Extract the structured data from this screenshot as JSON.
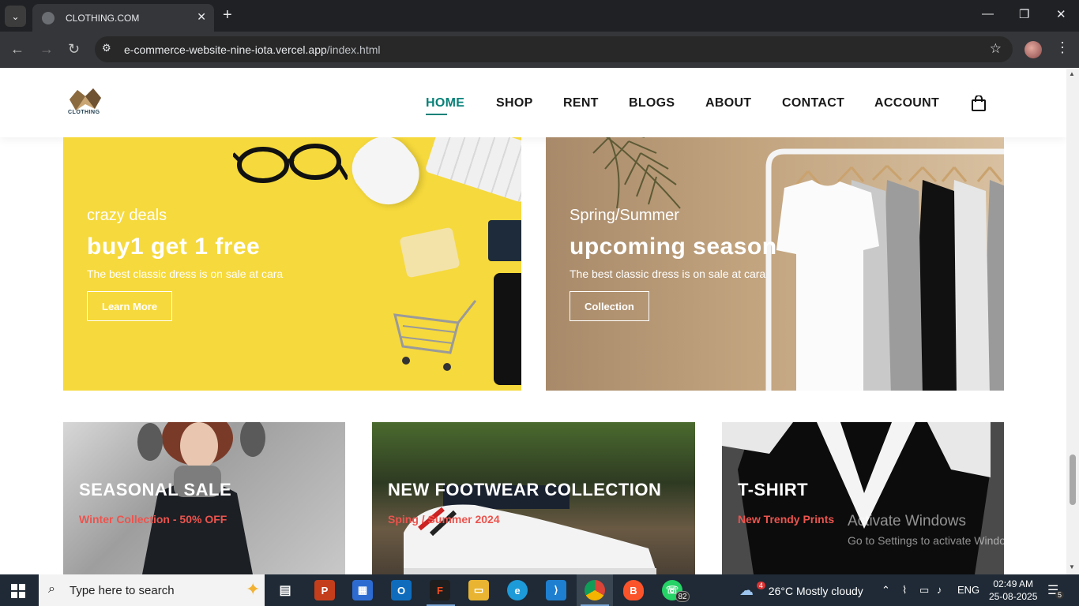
{
  "browser": {
    "tab_title": "CLOTHING.COM",
    "url_host": "e-commerce-website-nine-iota.vercel.app",
    "url_path": "/index.html"
  },
  "site": {
    "logo_text": "CLOTHING",
    "nav": [
      {
        "label": "HOME",
        "active": true
      },
      {
        "label": "SHOP"
      },
      {
        "label": "RENT"
      },
      {
        "label": "BLOGS"
      },
      {
        "label": "ABOUT"
      },
      {
        "label": "CONTACT"
      },
      {
        "label": "ACCOUNT"
      }
    ]
  },
  "banners": [
    {
      "small": "crazy deals",
      "big": "buy1 get 1 free",
      "desc": "The best classic dress is on sale at cara",
      "button": "Learn More"
    },
    {
      "small": "Spring/Summer",
      "big": "upcoming season",
      "desc": "The best classic dress is on sale at cara",
      "button": "Collection"
    }
  ],
  "cards": [
    {
      "title": "SEASONAL SALE",
      "subtitle": "Winter Collection - 50% OFF"
    },
    {
      "title": "NEW FOOTWEAR COLLECTION",
      "subtitle": "Sping / Summer 2024"
    },
    {
      "title": "T-SHIRT",
      "subtitle": "New Trendy Prints"
    }
  ],
  "watermark": {
    "line1": "Activate Windows",
    "line2": "Go to Settings to activate Windows."
  },
  "taskbar": {
    "search_placeholder": "Type here to search",
    "whatsapp_badge": "82",
    "weather_temp": "26°C",
    "weather_text": "Mostly cloudy",
    "weather_badge": "4",
    "lang": "ENG",
    "time": "02:49 AM",
    "date": "25-08-2025",
    "notif_count": "5"
  },
  "colors": {
    "accent": "#088178",
    "subtitle_red": "#ec544e",
    "banner_yellow": "#f6d93c"
  }
}
